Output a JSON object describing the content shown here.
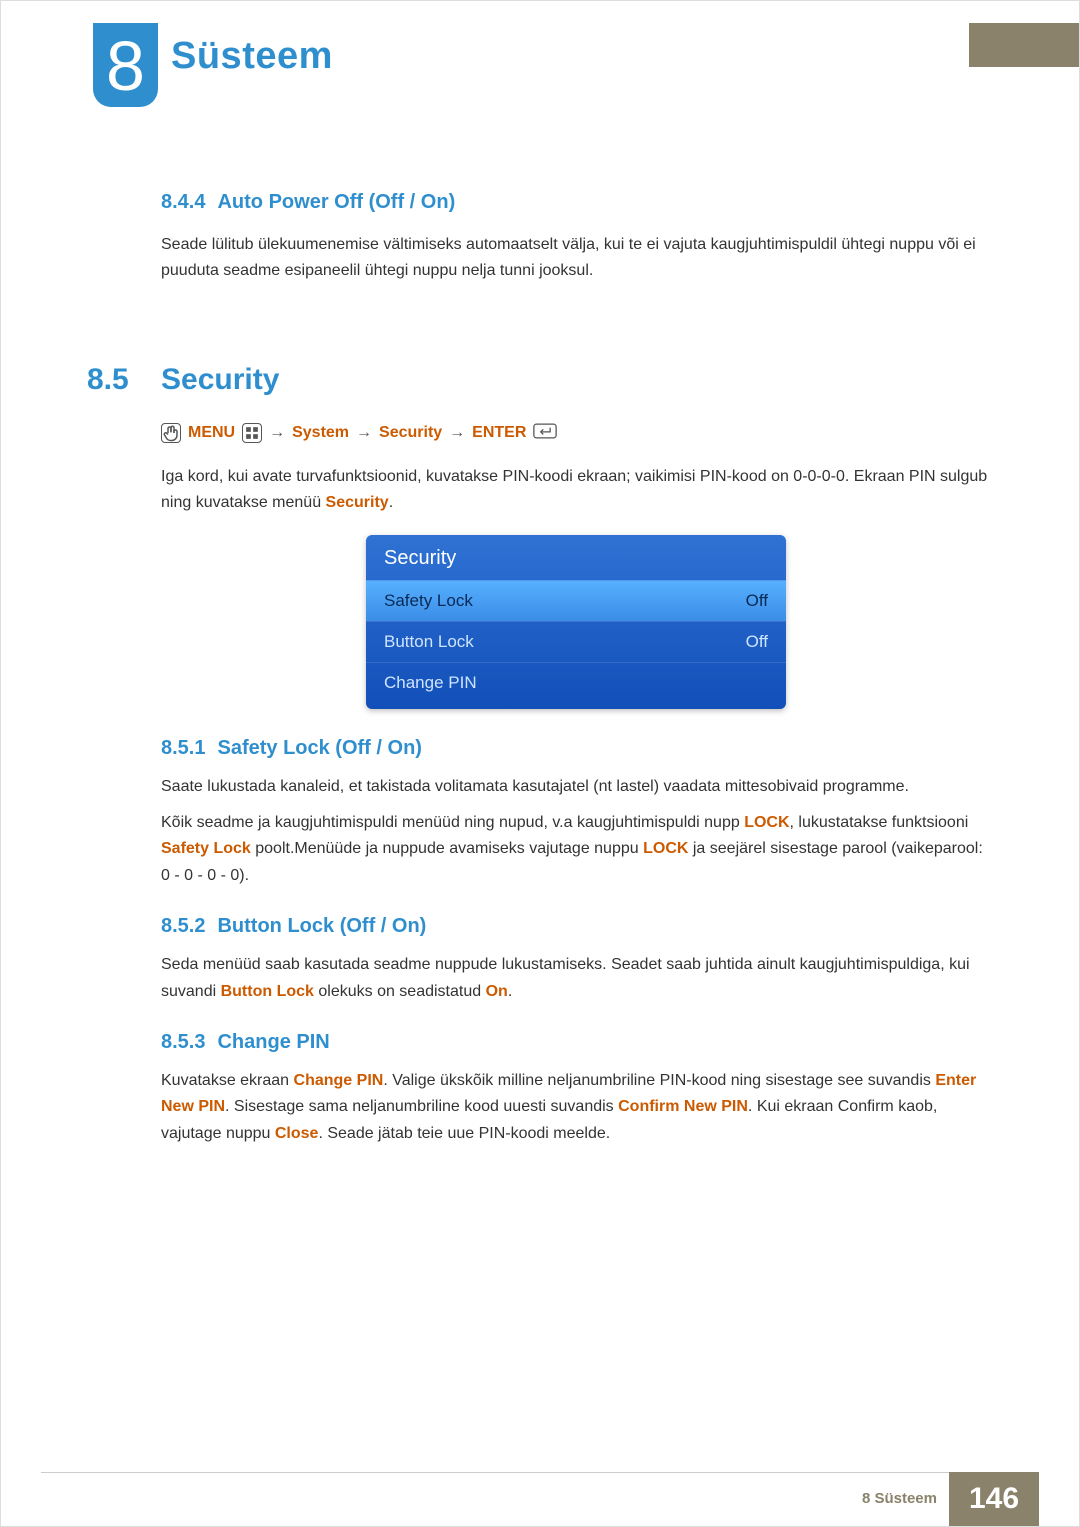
{
  "chapter": {
    "number": "8",
    "title": "Süsteem"
  },
  "s844": {
    "num": "8.4.4",
    "title": "Auto Power Off (Off / On)",
    "body": "Seade lülitub ülekuumenemise vältimiseks automaatselt välja, kui te ei vajuta kaugjuhtimispuldil ühtegi nuppu või ei puuduta seadme esipaneelil ühtegi nuppu nelja tunni jooksul."
  },
  "s85": {
    "num": "8.5",
    "title": "Security",
    "nav": {
      "menu": "MENU",
      "arrow": "→",
      "system": "System",
      "security": "Security",
      "enter": "ENTER"
    },
    "intro1": "Iga kord, kui avate turvafunktsioonid, kuvatakse PIN-koodi ekraan; vaikimisi PIN-kood on 0-0-0-0. Ekraan PIN sulgub ning kuvatakse menüü ",
    "intro_em": "Security",
    "intro2": "."
  },
  "osd": {
    "title": "Security",
    "rows": [
      {
        "label": "Safety Lock",
        "value": "Off",
        "hl": true
      },
      {
        "label": "Button Lock",
        "value": "Off",
        "hl": false
      },
      {
        "label": "Change PIN",
        "value": "",
        "hl": false
      }
    ]
  },
  "s851": {
    "num": "8.5.1",
    "title": "Safety Lock (Off / On)",
    "p1": "Saate lukustada kanaleid, et takistada volitamata kasutajatel (nt lastel) vaadata mittesobivaid programme.",
    "p2a": "Kõik seadme ja kaugjuhtimispuldi menüüd ning nupud, v.a kaugjuhtimispuldi nupp ",
    "p2_em1": "LOCK",
    "p2b": ", lukustatakse funktsiooni ",
    "p2_em2": "Safety Lock",
    "p2c": " poolt.Menüüde ja nuppude avamiseks vajutage nuppu ",
    "p2_em3": "LOCK",
    "p2d": "  ja seejärel sisestage parool (vaikeparool: 0 - 0 - 0 - 0)."
  },
  "s852": {
    "num": "8.5.2",
    "title": "Button Lock (Off / On)",
    "p1a": "Seda menüüd saab kasutada seadme nuppude lukustamiseks. Seadet saab juhtida ainult kaugjuhtimispuldiga, kui suvandi ",
    "p1_em1": "Button Lock",
    "p1b": " olekuks on seadistatud ",
    "p1_em2": "On",
    "p1c": "."
  },
  "s853": {
    "num": "8.5.3",
    "title": "Change PIN",
    "p1a": "Kuvatakse ekraan ",
    "p1_em1": "Change PIN",
    "p1b": ". Valige ükskõik milline neljanumbriline PIN-kood ning sisestage see suvandis ",
    "p1_em2": "Enter New PIN",
    "p1c": ". Sisestage sama neljanumbriline kood uuesti suvandis ",
    "p1_em3": "Confirm New PIN",
    "p1d": ". Kui ekraan Confirm kaob, vajutage nuppu ",
    "p1_em4": "Close",
    "p1e": ". Seade jätab teie uue PIN-koodi meelde."
  },
  "footer": {
    "text": "8 Süsteem",
    "page": "146"
  }
}
